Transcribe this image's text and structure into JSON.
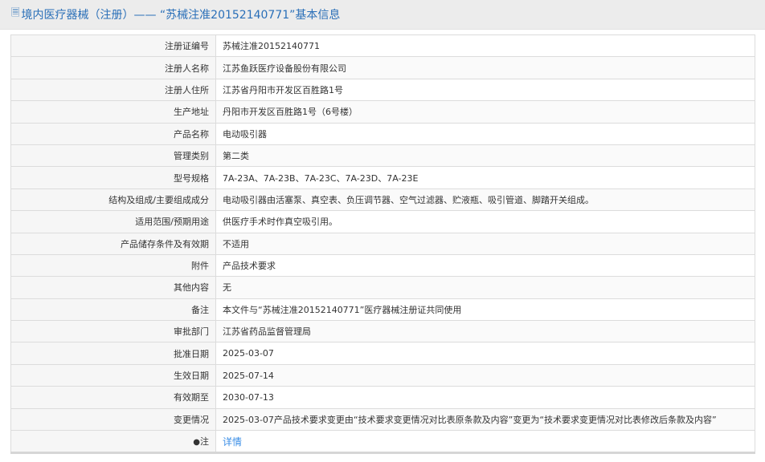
{
  "header": {
    "icon": "document-icon",
    "title": "境内医疗器械（注册）—— “苏械注准20152140771”基本信息"
  },
  "rows": [
    {
      "label": "注册证编号",
      "value": "苏械注准20152140771"
    },
    {
      "label": "注册人名称",
      "value": "江苏鱼跃医疗设备股份有限公司"
    },
    {
      "label": "注册人住所",
      "value": "江苏省丹阳市开发区百胜路1号"
    },
    {
      "label": "生产地址",
      "value": "丹阳市开发区百胜路1号（6号楼）"
    },
    {
      "label": "产品名称",
      "value": "电动吸引器"
    },
    {
      "label": "管理类别",
      "value": "第二类"
    },
    {
      "label": "型号规格",
      "value": "7A-23A、7A-23B、7A-23C、7A-23D、7A-23E"
    },
    {
      "label": "结构及组成/主要组成成分",
      "value": "电动吸引器由活塞泵、真空表、负压调节器、空气过滤器、贮液瓶、吸引管道、脚踏开关组成。"
    },
    {
      "label": "适用范围/预期用途",
      "value": "供医疗手术时作真空吸引用。"
    },
    {
      "label": "产品储存条件及有效期",
      "value": "不适用"
    },
    {
      "label": "附件",
      "value": "产品技术要求"
    },
    {
      "label": "其他内容",
      "value": "无"
    },
    {
      "label": "备注",
      "value": "本文件与“苏械注准20152140771”医疗器械注册证共同使用"
    },
    {
      "label": "审批部门",
      "value": "江苏省药品监督管理局"
    },
    {
      "label": "批准日期",
      "value": "2025-03-07"
    },
    {
      "label": "生效日期",
      "value": "2025-07-14"
    },
    {
      "label": "有效期至",
      "value": "2030-07-13"
    },
    {
      "label": "变更情况",
      "value": "2025-03-07产品技术要求变更由“技术要求变更情况对比表原条款及内容”变更为“技术要求变更情况对比表修改后条款及内容”"
    }
  ],
  "note": {
    "icon": "map-pin-icon",
    "label": "注",
    "link": "详情"
  }
}
